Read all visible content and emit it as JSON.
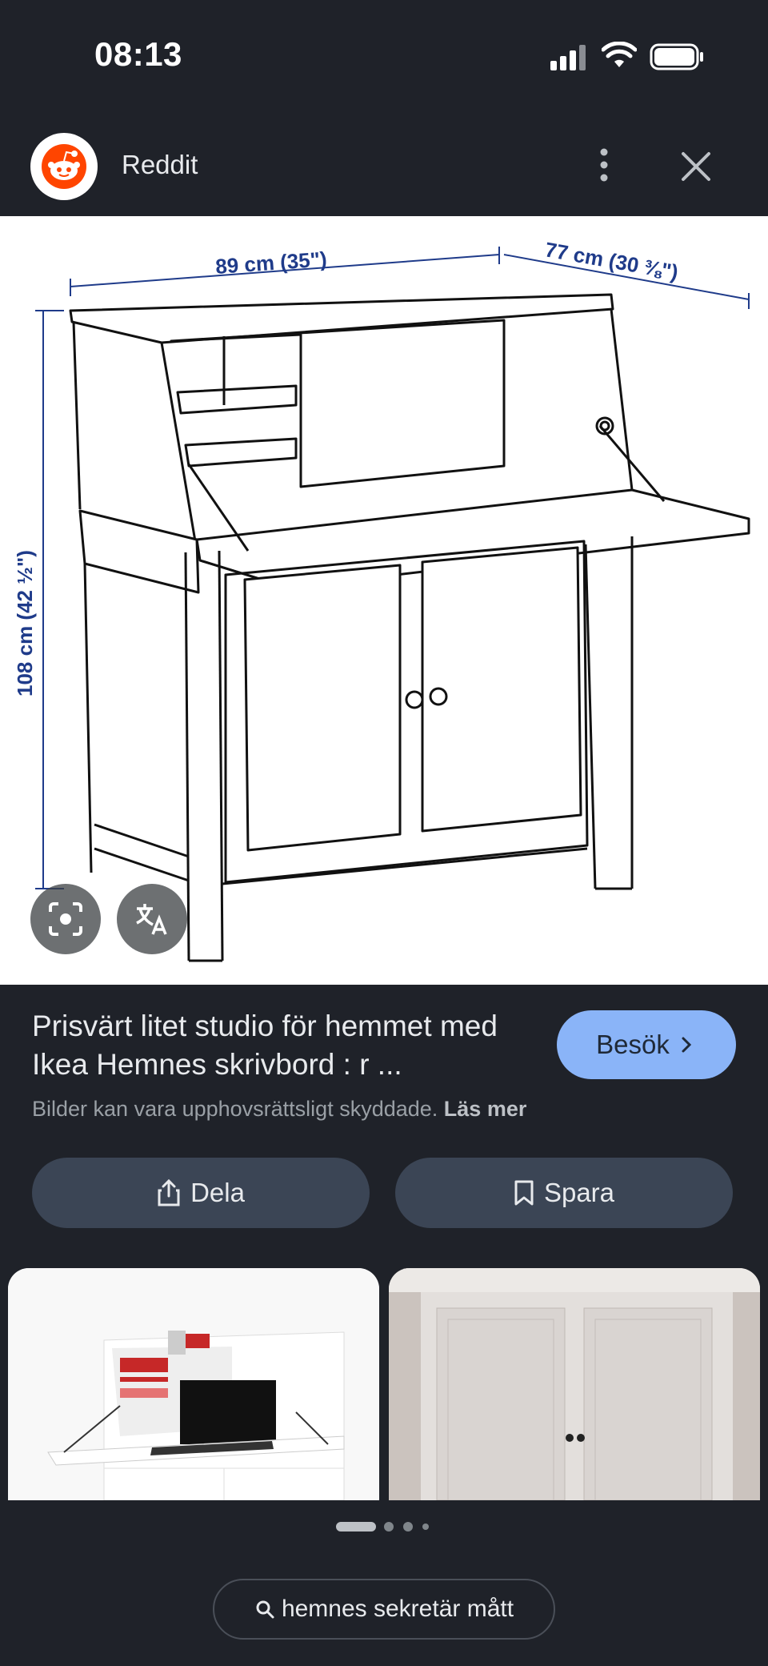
{
  "status_bar": {
    "time": "08:13"
  },
  "header": {
    "site_name": "Reddit"
  },
  "main_image": {
    "dimension_width": "89 cm (35\")",
    "dimension_depth": "77 cm (30 ⅜\")",
    "dimension_height": "108 cm (42 ½\")"
  },
  "caption": {
    "title": "Prisvärt litet studio för hemmet med Ikea Hemnes skrivbord : r ...",
    "copyright": "Bilder kan vara upphovsrättsligt skyddade.",
    "read_more": "Läs mer",
    "visit_label": "Besök"
  },
  "actions": {
    "share_label": "Dela",
    "save_label": "Spara"
  },
  "pagination": {
    "pages": 4,
    "active": 1
  },
  "search_chip": {
    "query": "hemnes sekretär mått"
  },
  "colors": {
    "background": "#1f2229",
    "accent": "#8ab4f8",
    "pill": "#3b4555",
    "reddit_orange": "#ff4500",
    "dimension_blue": "#1f3b8a"
  },
  "icons": [
    "signal-icon",
    "wifi-icon",
    "battery-icon",
    "reddit-logo-icon",
    "more-vert-icon",
    "close-icon",
    "lens-icon",
    "translate-icon",
    "chevron-right-icon",
    "share-icon",
    "bookmark-icon",
    "search-icon"
  ]
}
